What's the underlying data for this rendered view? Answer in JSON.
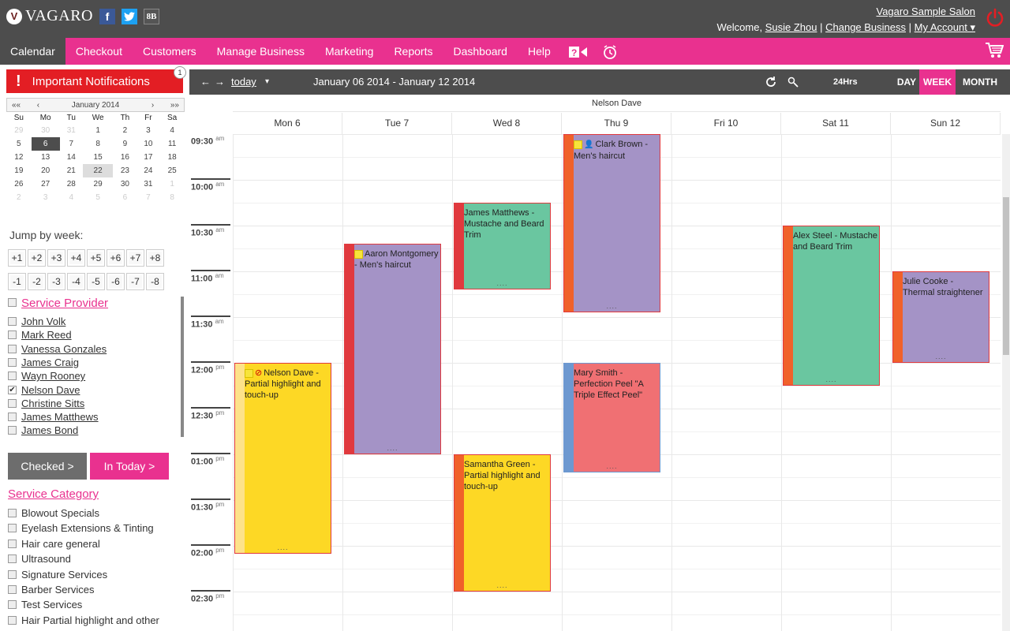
{
  "header": {
    "logo_text": "VAGARO",
    "facebook": "f",
    "twitter": "t",
    "badge": "8B",
    "salon": "Vagaro Sample Salon",
    "welcome": "Welcome,",
    "user": "Susie Zhou",
    "sep1": "|",
    "change_business": "Change Business",
    "sep2": "|",
    "my_account": "My Account ▾"
  },
  "nav": {
    "items": [
      "Calendar",
      "Checkout",
      "Customers",
      "Manage Business",
      "Marketing",
      "Reports",
      "Dashboard",
      "Help"
    ],
    "active": "Calendar"
  },
  "sidebar": {
    "notifications": {
      "label": "Important Notifications",
      "bang": "!",
      "count": "1"
    },
    "mini_calendar": {
      "prev2": "««",
      "prev": "‹",
      "month": "January 2014",
      "next": "›",
      "next2": "»»",
      "weekdays": [
        "Su",
        "Mo",
        "Tu",
        "We",
        "Th",
        "Fr",
        "Sa"
      ],
      "weeks": [
        [
          "29",
          "30",
          "31",
          "1",
          "2",
          "3",
          "4"
        ],
        [
          "5",
          "6",
          "7",
          "8",
          "9",
          "10",
          "11"
        ],
        [
          "12",
          "13",
          "14",
          "15",
          "16",
          "17",
          "18"
        ],
        [
          "19",
          "20",
          "21",
          "22",
          "23",
          "24",
          "25"
        ],
        [
          "26",
          "27",
          "28",
          "29",
          "30",
          "31",
          "1"
        ],
        [
          "2",
          "3",
          "4",
          "5",
          "6",
          "7",
          "8"
        ]
      ]
    },
    "jump_label": "Jump by week:",
    "jump_plus": [
      "+1",
      "+2",
      "+3",
      "+4",
      "+5",
      "+6",
      "+7",
      "+8"
    ],
    "jump_minus": [
      "-1",
      "-2",
      "-3",
      "-4",
      "-5",
      "-6",
      "-7",
      "-8"
    ],
    "provider_title": "Service Provider",
    "providers": [
      {
        "name": "John Volk",
        "checked": false
      },
      {
        "name": "Mark Reed",
        "checked": false
      },
      {
        "name": "Vanessa Gonzales",
        "checked": false
      },
      {
        "name": "James Craig",
        "checked": false
      },
      {
        "name": "Wayn Rooney",
        "checked": false
      },
      {
        "name": "Nelson Dave",
        "checked": true
      },
      {
        "name": "Christine Sitts",
        "checked": false
      },
      {
        "name": "James Matthews",
        "checked": false
      },
      {
        "name": "James Bond",
        "checked": false
      }
    ],
    "checked_btn": "Checked >",
    "in_today_btn": "In Today >",
    "category_title": "Service Category",
    "categories": [
      "Blowout Specials",
      "Eyelash Extensions & Tinting",
      "Hair care general",
      "Ultrasound",
      "Signature Services",
      "Barber Services",
      "Test Services",
      "Hair Partial highlight and other"
    ]
  },
  "toolbar": {
    "prev": "←",
    "next": "→",
    "today": "today",
    "caret": "▾",
    "range": "January 06 2014 - January 12 2014",
    "hrs24": "24Hrs",
    "day": "DAY",
    "week": "WEEK",
    "month": "MONTH",
    "active_view": "WEEK"
  },
  "calendar": {
    "provider": "Nelson Dave",
    "days": [
      "Mon 6",
      "Tue 7",
      "Wed 8",
      "Thu 9",
      "Fri 10",
      "Sat 11",
      "Sun 12"
    ],
    "times": [
      {
        "t": "09:30",
        "ap": "am"
      },
      {
        "t": "10:00",
        "ap": "am"
      },
      {
        "t": "10:30",
        "ap": "am"
      },
      {
        "t": "11:00",
        "ap": "am"
      },
      {
        "t": "11:30",
        "ap": "am"
      },
      {
        "t": "12:00",
        "ap": "pm"
      },
      {
        "t": "12:30",
        "ap": "pm"
      },
      {
        "t": "01:00",
        "ap": "pm"
      },
      {
        "t": "01:30",
        "ap": "pm"
      },
      {
        "t": "02:00",
        "ap": "pm"
      },
      {
        "t": "02:30",
        "ap": "pm"
      }
    ],
    "appointments": [
      {
        "day": 0,
        "start": "12:00",
        "end": "14:05",
        "text": "Nelson Dave - Partial highlight and touch-up",
        "color": "#fdd825",
        "bar": "#fde28a",
        "icons": "note-cancel"
      },
      {
        "day": 1,
        "start": "10:42",
        "end": "13:00",
        "text": "Aaron Montgomery - Men's haircut",
        "color": "#a493c6",
        "bar": "#e0393e",
        "icons": "note"
      },
      {
        "day": 2,
        "start": "10:15",
        "end": "11:12",
        "text": "James Matthews - Mustache and Beard Trim",
        "color": "#6ac6a0",
        "bar": "#e0393e",
        "icons": ""
      },
      {
        "day": 2,
        "start": "13:00",
        "end": "14:30",
        "text": "Samantha Green - Partial highlight and touch-up",
        "color": "#fdd825",
        "bar": "#f0612a",
        "icons": ""
      },
      {
        "day": 3,
        "start": "09:30",
        "end": "11:27",
        "text": "Clark Brown - Men's haircut",
        "color": "#a493c6",
        "bar": "#f0612a",
        "icons": "note-person"
      },
      {
        "day": 3,
        "start": "12:00",
        "end": "13:12",
        "text": "Mary Smith - Perfection Peel \"A Triple Effect Peel\"",
        "color": "#f07073",
        "bar": "#6d98d0",
        "icons": ""
      },
      {
        "day": 5,
        "start": "10:30",
        "end": "12:15",
        "text": "Alex Steel - Mustache and Beard Trim",
        "color": "#6ac6a0",
        "bar": "#f0612a",
        "icons": ""
      },
      {
        "day": 6,
        "start": "11:00",
        "end": "12:00",
        "text": "Julie Cooke - Thermal straightener",
        "color": "#a493c6",
        "bar": "#f0612a",
        "icons": ""
      }
    ],
    "more": "...."
  }
}
